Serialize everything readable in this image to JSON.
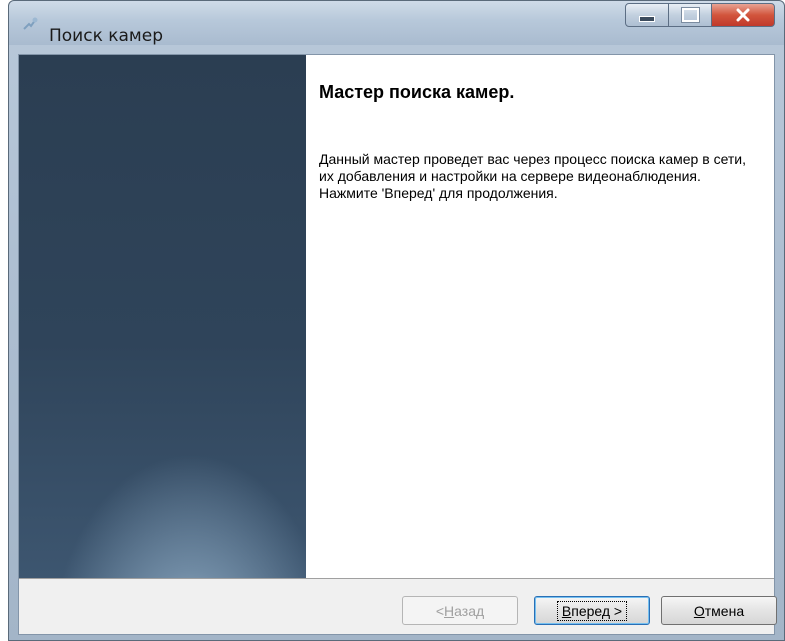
{
  "window": {
    "title": "Поиск камер",
    "controls": {
      "minimize": "minimize",
      "maximize": "maximize",
      "close": "x"
    }
  },
  "wizard": {
    "heading": "Мастер поиска камер.",
    "description": "Данный мастер проведет вас через процесс поиска камер в сети, их добавления и настройки на сервере видеонаблюдения. Нажмите 'Вперед' для продолжения."
  },
  "buttons": {
    "back": {
      "prefix": "< ",
      "hotkey": "Н",
      "rest": "азад",
      "enabled": false
    },
    "next": {
      "hotkey": "В",
      "rest": "перед >",
      "enabled": true
    },
    "cancel": {
      "hotkey": "О",
      "rest": "тмена",
      "enabled": true
    }
  },
  "colors": {
    "side_panel_top": "#2b3e52",
    "side_panel_glow": "#a8c0d4",
    "close_button": "#d2553d",
    "default_button_border": "#2a6fb5"
  }
}
